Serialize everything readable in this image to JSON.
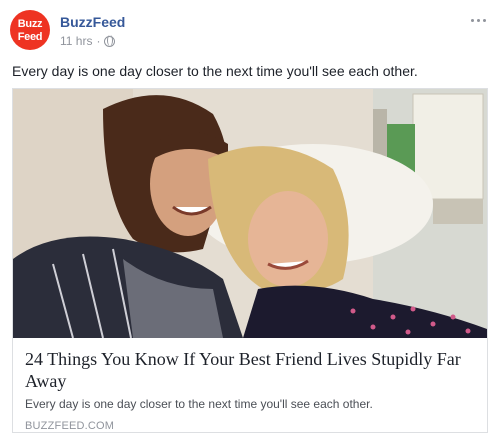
{
  "page": {
    "name": "BuzzFeed",
    "avatar_text": [
      "Buzz",
      "Feed"
    ],
    "timestamp": "11 hrs",
    "privacy_icon": "globe-icon",
    "options_icon": "more-horizontal-icon"
  },
  "post": {
    "message": "Every day is one day closer to the next time you'll see each other."
  },
  "link": {
    "title": "24 Things You Know If Your Best Friend Lives Stupidly Far Away",
    "description": "Every day is one day closer to the next time you'll see each other.",
    "domain": "BUZZFEED.COM"
  },
  "colors": {
    "brand_red": "#ee3322",
    "page_link": "#365899",
    "meta_grey": "#90949c"
  }
}
